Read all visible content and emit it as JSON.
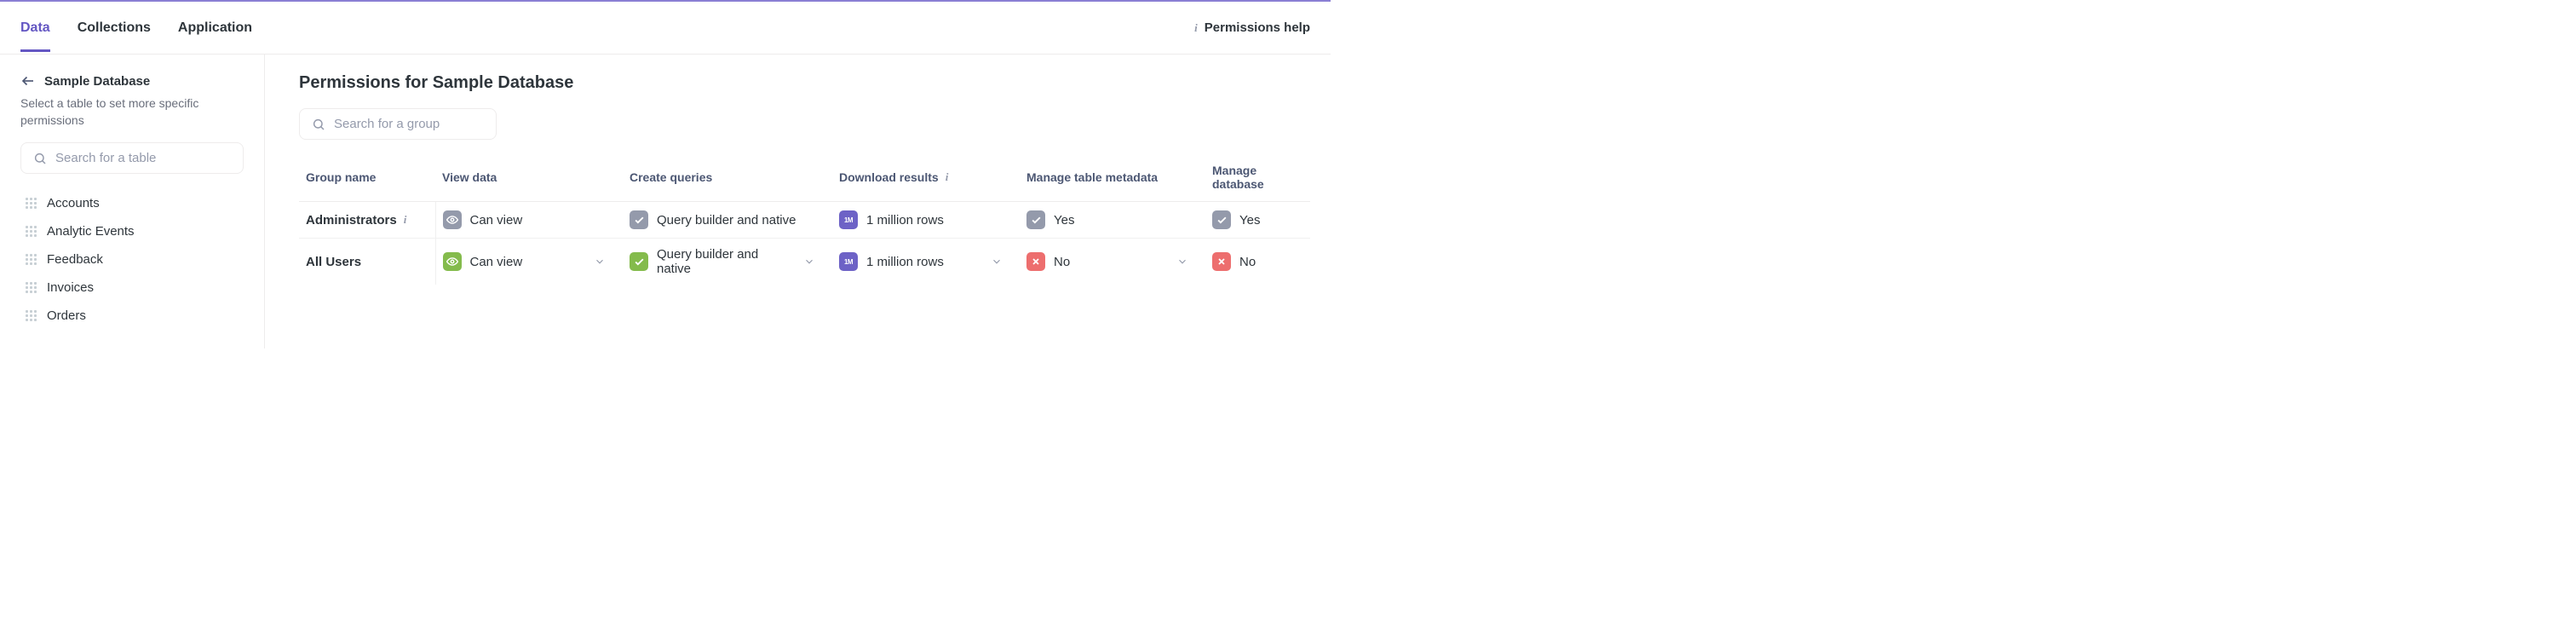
{
  "header": {
    "tabs": [
      {
        "id": "data",
        "label": "Data",
        "active": true
      },
      {
        "id": "collections",
        "label": "Collections",
        "active": false
      },
      {
        "id": "application",
        "label": "Application",
        "active": false
      }
    ],
    "help_label": "Permissions help"
  },
  "sidebar": {
    "title": "Sample Database",
    "subtitle": "Select a table to set more specific permissions",
    "search_placeholder": "Search for a table",
    "tables": [
      {
        "name": "Accounts"
      },
      {
        "name": "Analytic Events"
      },
      {
        "name": "Feedback"
      },
      {
        "name": "Invoices"
      },
      {
        "name": "Orders"
      }
    ]
  },
  "main": {
    "title": "Permissions for Sample Database",
    "search_placeholder": "Search for a group",
    "columns": {
      "group": "Group name",
      "view": "View data",
      "create": "Create queries",
      "download": "Download results",
      "meta": "Manage table metadata",
      "db": "Manage database"
    },
    "rows": [
      {
        "group": "Administrators",
        "locked": true,
        "view": {
          "label": "Can view",
          "badge": "eye",
          "color": "gray"
        },
        "create": {
          "label": "Query builder and native",
          "badge": "check",
          "color": "gray"
        },
        "download": {
          "label": "1 million rows",
          "badge": "1m",
          "color": "purple"
        },
        "meta": {
          "label": "Yes",
          "badge": "check",
          "color": "gray"
        },
        "db": {
          "label": "Yes",
          "badge": "check",
          "color": "gray"
        }
      },
      {
        "group": "All Users",
        "locked": false,
        "view": {
          "label": "Can view",
          "badge": "eye",
          "color": "green"
        },
        "create": {
          "label": "Query builder and native",
          "badge": "check",
          "color": "green"
        },
        "download": {
          "label": "1 million rows",
          "badge": "1m",
          "color": "purple"
        },
        "meta": {
          "label": "No",
          "badge": "x",
          "color": "red"
        },
        "db": {
          "label": "No",
          "badge": "x",
          "color": "red"
        }
      }
    ]
  }
}
